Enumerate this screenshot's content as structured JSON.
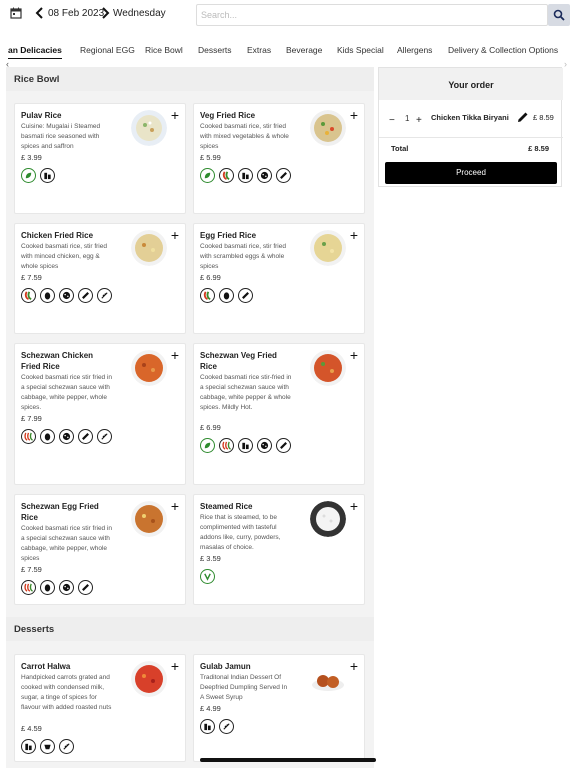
{
  "header": {
    "date": "08 Feb 2023",
    "day": "Wednesday",
    "search_placeholder": "Search...",
    "icons": [
      "calendar-icon",
      "chevron-left-icon",
      "chevron-right-icon",
      "search-icon"
    ]
  },
  "tabs": [
    {
      "label": "Indian Delicacies",
      "display": "an Delicacies",
      "active": true
    },
    {
      "label": "Regional EGG"
    },
    {
      "label": "Rice Bowl"
    },
    {
      "label": "Desserts"
    },
    {
      "label": "Extras"
    },
    {
      "label": "Beverage"
    },
    {
      "label": "Kids Special"
    },
    {
      "label": "Allergens"
    },
    {
      "label": "Delivery & Collection Options"
    }
  ],
  "sections": {
    "rice_bowl": {
      "title": "Rice Bowl",
      "items": [
        {
          "name": "Pulav Rice",
          "desc": "Cuisine: Mugalai i Steamed basmati rice seasoned with spices and saffron",
          "price": "£ 3.99",
          "icons": [
            "vegetarian-icon",
            "milk-icon"
          ]
        },
        {
          "name": "Veg Fried Rice",
          "desc": "Cooked basmati rice, stir fried with mixed vegetables & whole spices",
          "price": "£ 5.99",
          "icons": [
            "vegetarian-icon",
            "chilli-icon",
            "milk-icon",
            "mustard-icon",
            "celery-icon"
          ]
        },
        {
          "name": "Chicken Fried Rice",
          "desc": "Cooked basmati rice, stir fried with minced chicken, egg & whole spices",
          "price": "£ 7.59",
          "icons": [
            "chilli-icon",
            "egg-icon",
            "mustard-icon",
            "celery-icon",
            "sesame-icon"
          ]
        },
        {
          "name": "Egg Fried Rice",
          "desc": "Cooked basmati rice, stir fried with scrambled eggs & whole spices",
          "price": "£ 6.99",
          "icons": [
            "chilli-icon",
            "egg-icon",
            "celery-icon"
          ]
        },
        {
          "name": "Schezwan Chicken Fried Rice",
          "desc": "Cooked basmati rice stir fried in a special schezwan sauce with cabbage, white pepper, whole spices.",
          "price": "£ 7.99",
          "icons": [
            "hot-chilli-icon",
            "egg-icon",
            "mustard-icon",
            "celery-icon",
            "sesame-icon"
          ]
        },
        {
          "name": "Schezwan Veg Fried Rice",
          "desc": "Cooked basmati rice stir-fried in a special schezwan sauce with cabbage, white pepper & whole spices. Mildly Hot.",
          "price": "£ 6.99",
          "icons": [
            "vegetarian-icon",
            "hot-chilli-icon",
            "milk-icon",
            "mustard-icon",
            "celery-icon"
          ]
        },
        {
          "name": "Schezwan Egg Fried Rice",
          "desc": "Cooked basmati rice stir fried in a special schezwan sauce with cabbage, white pepper, whole spices",
          "price": "£ 7.59",
          "icons": [
            "hot-chilli-icon",
            "egg-icon",
            "mustard-icon",
            "celery-icon"
          ]
        },
        {
          "name": "Steamed Rice",
          "desc": "Rice that is steamed, to be complimented with tasteful addons like, curry, powders, masalas of choice.",
          "price": "£ 3.59",
          "icons": [
            "vegan-icon"
          ]
        }
      ]
    },
    "desserts": {
      "title": "Desserts",
      "items": [
        {
          "name": "Carrot Halwa",
          "desc": "Handpicked carrots grated and cooked with condensed milk, sugar, a tinge of spices for flavour with added roasted nuts",
          "price": "£ 4.59",
          "icons": [
            "milk-icon",
            "nuts-icon",
            "sesame-icon"
          ]
        },
        {
          "name": "Gulab Jamun",
          "desc": "Traditonal Indian Dessert Of Deepfried Dumpling Served In A Sweet Syrup",
          "price": "£ 4.99",
          "icons": [
            "milk-icon",
            "sesame-icon"
          ]
        }
      ]
    }
  },
  "order": {
    "title": "Your order",
    "items": [
      {
        "qty": "1",
        "name": "Chicken Tikka Biryani",
        "price": "£ 8.59"
      }
    ],
    "total_label": "Total",
    "total_value": "£ 8.59",
    "proceed_label": "Proceed",
    "qty_minus": "−",
    "qty_plus": "+"
  },
  "colors": {
    "accent": "#000000",
    "veg_green": "#2e8b2e",
    "chilli_red": "#d23a1e",
    "section_bg": "#eeeeee",
    "page_bg": "#f3f3f3"
  }
}
